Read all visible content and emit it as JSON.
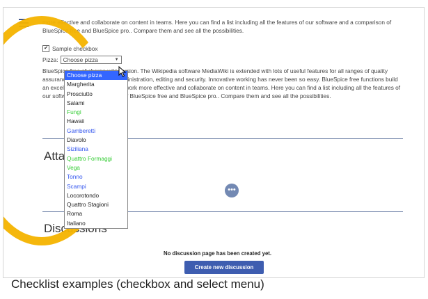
{
  "intro_paragraph": "more effective and collaborate on content in teams. Here you can find a list including all the features of our software and a comparison of BlueSpice free and BlueSpice pro.. Compare them and see all the possibilities.",
  "checkbox": {
    "label": "Sample checkbox",
    "checked": true
  },
  "pizza": {
    "label": "Pizza:",
    "selected": "Choose pizza",
    "options": [
      {
        "label": "Choose pizza",
        "color": "#ffffff"
      },
      {
        "label": "Margherita",
        "color": "#222222"
      },
      {
        "label": "Prosciutto",
        "color": "#222222"
      },
      {
        "label": "Salami",
        "color": "#222222"
      },
      {
        "label": "Fungi",
        "color": "#33cc33"
      },
      {
        "label": "Hawaii",
        "color": "#222222"
      },
      {
        "label": "Gamberetti",
        "color": "#3355ee"
      },
      {
        "label": "Diavolo",
        "color": "#222222"
      },
      {
        "label": "Siziliana",
        "color": "#3355ee"
      },
      {
        "label": "Quattro Formaggi",
        "color": "#33cc33"
      },
      {
        "label": "Vega",
        "color": "#33cc33"
      },
      {
        "label": "Tonno",
        "color": "#3355ee"
      },
      {
        "label": "Scampi",
        "color": "#3355ee"
      },
      {
        "label": "Locorotondo",
        "color": "#222222"
      },
      {
        "label": "Quattro Stagioni",
        "color": "#222222"
      },
      {
        "label": "Roma",
        "color": "#222222"
      },
      {
        "label": "Italiano",
        "color": "#222222"
      }
    ]
  },
  "body_paragraph": "BlueSpice free of charge wiki version. The Wikipedia software MediaWiki is extended with lots of useful features for all ranges of quality assurance, process support, administration, editing and security. Innovative working has never been so easy. BlueSpice free functions build an excellent basis to make your work more effective and collaborate on content in teams. Here you can find a list including all the features of our software and a comparison of BlueSpice free and BlueSpice pro.. Compare them and see all the possibilities.",
  "attachments_heading": "Attachments",
  "discussions_heading": "Discussions",
  "no_discussion_text": "No discussion page has been created yet.",
  "create_discussion_label": "Create new discussion",
  "caption": "Checklist examples (checkbox and select menu)",
  "accent_color": "#3e5db0",
  "highlight_color": "#f5b400"
}
